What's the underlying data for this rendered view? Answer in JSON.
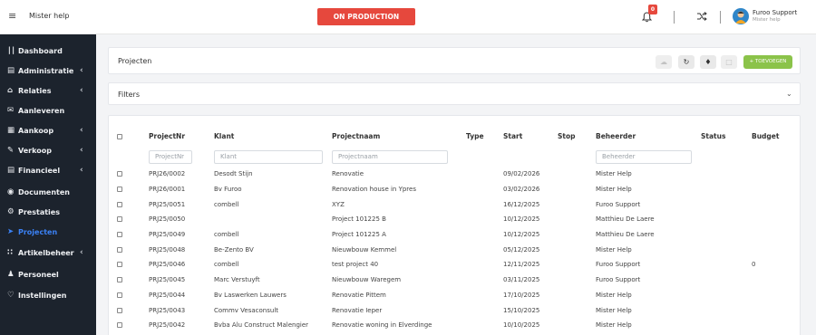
{
  "app": {
    "name": "Mister help",
    "environment": "ON PRODUCTION"
  },
  "notifications": {
    "count": "0",
    "icon": "bell-icon"
  },
  "user": {
    "name": "Furoo Support",
    "sub": "Mister help"
  },
  "colors": {
    "sidebar_bg": "#1c232d",
    "active": "#3b82f6",
    "production_badge": "#e6483d",
    "add_button": "#8bc34a"
  },
  "sidebar": {
    "items": [
      {
        "label": "Dashboard",
        "icon": "bar-chart-icon",
        "chevron": false
      },
      {
        "label": "Administratie",
        "icon": "document-icon",
        "chevron": true
      },
      {
        "label": "Relaties",
        "icon": "home-icon",
        "chevron": true
      },
      {
        "label": "Aanleveren",
        "icon": "mail-icon",
        "chevron": false
      },
      {
        "label": "Aankoop",
        "icon": "grid-icon",
        "chevron": true
      },
      {
        "label": "Verkoop",
        "icon": "pen-icon",
        "chevron": true
      },
      {
        "label": "Financieel",
        "icon": "file-icon",
        "chevron": true
      },
      {
        "label": "Documenten",
        "icon": "archive-icon",
        "chevron": false
      },
      {
        "label": "Prestaties",
        "icon": "gear-icon",
        "chevron": false
      },
      {
        "label": "Projecten",
        "icon": "send-icon",
        "chevron": false,
        "active": true
      },
      {
        "label": "Artikelbeheer",
        "icon": "apps-icon",
        "chevron": true
      },
      {
        "label": "Personeel",
        "icon": "person-icon",
        "chevron": false
      },
      {
        "label": "Instellingen",
        "icon": "heart-icon",
        "chevron": false
      }
    ]
  },
  "page": {
    "title": "Projecten",
    "filters_label": "Filters",
    "add_label": "+ TOEVOEGEN"
  },
  "table": {
    "columns": [
      "ProjectNr",
      "Klant",
      "Projectnaam",
      "Type",
      "Start",
      "Stop",
      "Beheerder",
      "Status",
      "Budget"
    ],
    "filters": {
      "projectnr": "ProjectNr",
      "klant": "Klant",
      "projectnaam": "Projectnaam",
      "beheerder": "Beheerder"
    },
    "rows": [
      {
        "nr": "PRJ26/0002",
        "klant": "Desodt Stijn",
        "naam": "Renovatie",
        "type": "",
        "start": "09/02/2026",
        "stop": "",
        "beheerder": "Mister Help",
        "status": "",
        "budget": ""
      },
      {
        "nr": "PRJ26/0001",
        "klant": "Bv Furoo",
        "naam": "Renovation house in Ypres",
        "type": "",
        "start": "03/02/2026",
        "stop": "",
        "beheerder": "Mister Help",
        "status": "",
        "budget": ""
      },
      {
        "nr": "PRJ25/0051",
        "klant": "combell",
        "naam": "XYZ",
        "type": "",
        "start": "16/12/2025",
        "stop": "",
        "beheerder": "Furoo Support",
        "status": "",
        "budget": ""
      },
      {
        "nr": "PRJ25/0050",
        "klant": "",
        "naam": "Project 101225 B",
        "type": "",
        "start": "10/12/2025",
        "stop": "",
        "beheerder": "Matthieu De Laere",
        "status": "",
        "budget": ""
      },
      {
        "nr": "PRJ25/0049",
        "klant": "combell",
        "naam": "Project 101225 A",
        "type": "",
        "start": "10/12/2025",
        "stop": "",
        "beheerder": "Matthieu De Laere",
        "status": "",
        "budget": ""
      },
      {
        "nr": "PRJ25/0048",
        "klant": "Be-Zento BV",
        "naam": "Nieuwbouw Kemmel",
        "type": "",
        "start": "05/12/2025",
        "stop": "",
        "beheerder": "Mister Help",
        "status": "",
        "budget": ""
      },
      {
        "nr": "PRJ25/0046",
        "klant": "combell",
        "naam": "test project 40",
        "type": "",
        "start": "12/11/2025",
        "stop": "",
        "beheerder": "Furoo Support",
        "status": "",
        "budget": "0"
      },
      {
        "nr": "PRJ25/0045",
        "klant": "Marc Verstuyft",
        "naam": "Nieuwbouw Waregem",
        "type": "",
        "start": "03/11/2025",
        "stop": "",
        "beheerder": "Furoo Support",
        "status": "",
        "budget": ""
      },
      {
        "nr": "PRJ25/0044",
        "klant": "Bv Laswerken Lauwers",
        "naam": "Renovatie Pittem",
        "type": "",
        "start": "17/10/2025",
        "stop": "",
        "beheerder": "Mister Help",
        "status": "",
        "budget": ""
      },
      {
        "nr": "PRJ25/0043",
        "klant": "Commv Vesaconsult",
        "naam": "Renovatie Ieper",
        "type": "",
        "start": "15/10/2025",
        "stop": "",
        "beheerder": "Mister Help",
        "status": "",
        "budget": ""
      },
      {
        "nr": "PRJ25/0042",
        "klant": "Bvba Alu Construct Malengier",
        "naam": "Renovatie woning in Elverdinge",
        "type": "",
        "start": "10/10/2025",
        "stop": "",
        "beheerder": "Mister Help",
        "status": "",
        "budget": ""
      }
    ]
  }
}
